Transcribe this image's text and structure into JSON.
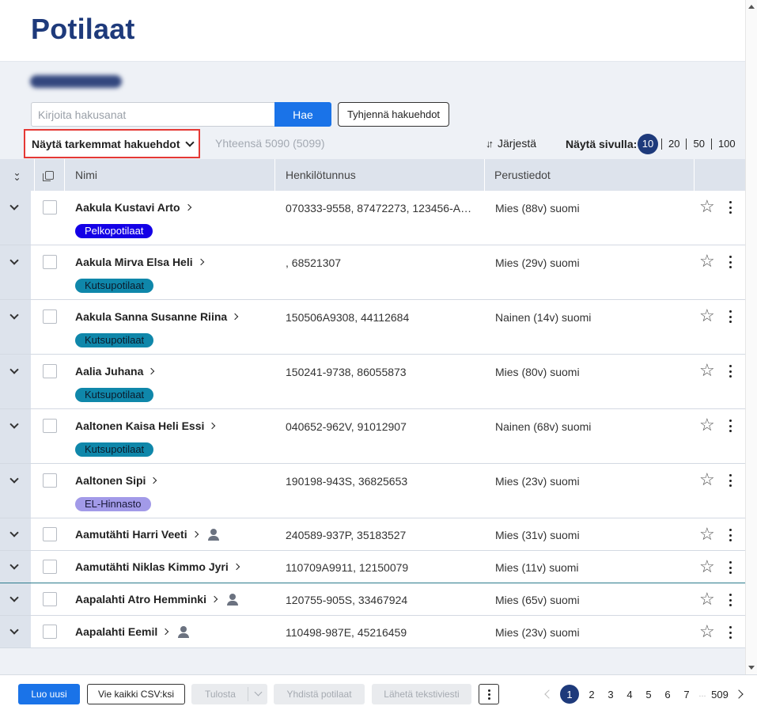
{
  "page": {
    "title": "Potilaat"
  },
  "search": {
    "placeholder": "Kirjoita hakusanat",
    "search_label": "Hae",
    "clear_label": "Tyhjennä hakuehdot",
    "advanced_label": "Näytä tarkemmat hakuehdot",
    "total_label": "Yhteensä 5090 (5099)"
  },
  "sort": {
    "label": "Järjestä"
  },
  "page_size": {
    "label": "Näytä sivulla:",
    "options": [
      "10",
      "20",
      "50",
      "100"
    ],
    "selected": "10"
  },
  "table": {
    "columns": [
      "Nimi",
      "Henkilötunnus",
      "Perustiedot"
    ],
    "rows": [
      {
        "name": "Aakula Kustavi Arto",
        "hetu": "070333-9558, 87472273, 123456-AA...",
        "info": "Mies (88v) suomi",
        "badge": "Pelkopotilaat",
        "badge_type": "pelko",
        "person_icon": false
      },
      {
        "name": "Aakula Mirva Elsa Heli",
        "hetu": ", 68521307",
        "info": "Mies (29v) suomi",
        "badge": "Kutsupotilaat",
        "badge_type": "kutsu",
        "person_icon": false
      },
      {
        "name": "Aakula Sanna Susanne Riina",
        "hetu": "150506A9308, 44112684",
        "info": "Nainen (14v) suomi",
        "badge": "Kutsupotilaat",
        "badge_type": "kutsu",
        "person_icon": false
      },
      {
        "name": "Aalia Juhana",
        "hetu": "150241-9738, 86055873",
        "info": "Mies (80v) suomi",
        "badge": "Kutsupotilaat",
        "badge_type": "kutsu",
        "person_icon": false
      },
      {
        "name": "Aaltonen Kaisa Heli Essi",
        "hetu": "040652-962V, 91012907",
        "info": "Nainen (68v) suomi",
        "badge": "Kutsupotilaat",
        "badge_type": "kutsu",
        "person_icon": false
      },
      {
        "name": "Aaltonen Sipi",
        "hetu": "190198-943S, 36825653",
        "info": "Mies (23v) suomi",
        "badge": "EL-Hinnasto",
        "badge_type": "el",
        "person_icon": false
      },
      {
        "name": "Aamutähti Harri Veeti",
        "hetu": "240589-937P, 35183527",
        "info": "Mies (31v) suomi",
        "badge": "",
        "badge_type": "",
        "person_icon": true
      },
      {
        "name": "Aamutähti Niklas Kimmo Jyri",
        "hetu": "110709A9911, 12150079",
        "info": "Mies (11v) suomi",
        "badge": "",
        "badge_type": "",
        "person_icon": false
      },
      {
        "name": "Aapalahti Atro Hemminki",
        "hetu": "120755-905S, 33467924",
        "info": "Mies (65v) suomi",
        "badge": "",
        "badge_type": "",
        "person_icon": true
      },
      {
        "name": "Aapalahti Eemil",
        "hetu": "110498-987E, 45216459",
        "info": "Mies (23v) suomi",
        "badge": "",
        "badge_type": "",
        "person_icon": true
      }
    ]
  },
  "footer": {
    "new_label": "Luo uusi",
    "csv_label": "Vie kaikki CSV:ksi",
    "print_label": "Tulosta",
    "merge_label": "Yhdistä potilaat",
    "sms_label": "Lähetä tekstiviesti"
  },
  "pagination": {
    "current": "1",
    "pages": [
      "2",
      "3",
      "4",
      "5",
      "6",
      "7"
    ],
    "ellipsis": "...",
    "last": "509"
  },
  "colors": {
    "title": "#1e3a7b",
    "primary": "#1a73e8",
    "highlight_border": "#e53935"
  }
}
